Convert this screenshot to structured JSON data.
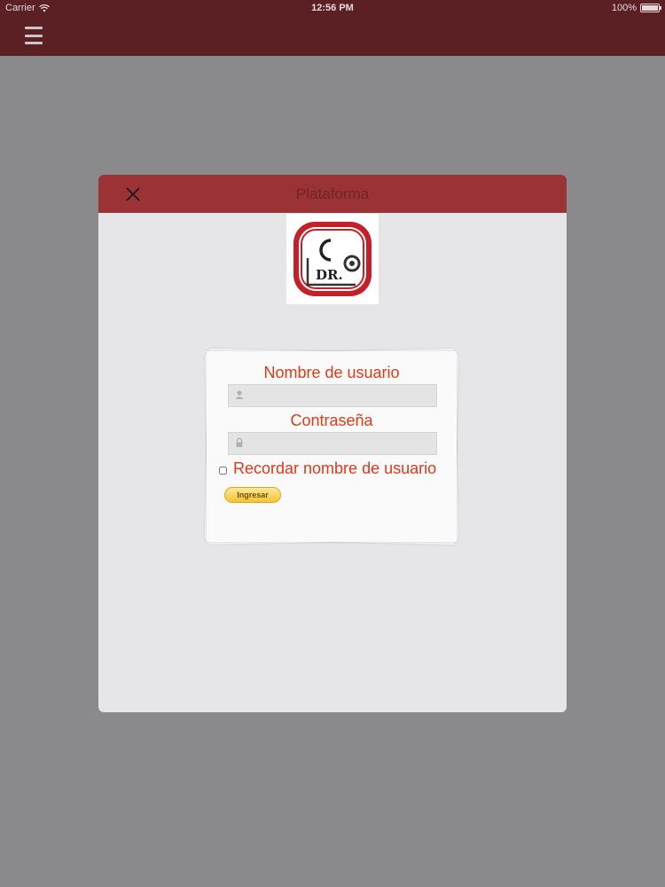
{
  "status_bar": {
    "carrier": "Carrier",
    "time": "12:56 PM",
    "battery": "100%"
  },
  "nav": {
    "menu_icon": "hamburger-menu-icon"
  },
  "modal": {
    "title": "Plataforma",
    "close_icon": "close-x-icon",
    "logo": {
      "text": "DR.",
      "colors": {
        "ring": "#c4202a",
        "mark": "#222222"
      }
    }
  },
  "login_form": {
    "username_label": "Nombre de usuario",
    "username_value": "",
    "username_icon": "user-icon",
    "password_label": "Contraseña",
    "password_value": "",
    "password_icon": "lock-icon",
    "remember_label": "Recordar nombre de usuario",
    "remember_checked": false,
    "submit_label": "Ingresar"
  },
  "colors": {
    "header_bar": "#5a2024",
    "modal_header": "#9b3336",
    "label_text": "#dd3a18",
    "button": "#f6c330",
    "backdrop": "#8a8a8c"
  }
}
